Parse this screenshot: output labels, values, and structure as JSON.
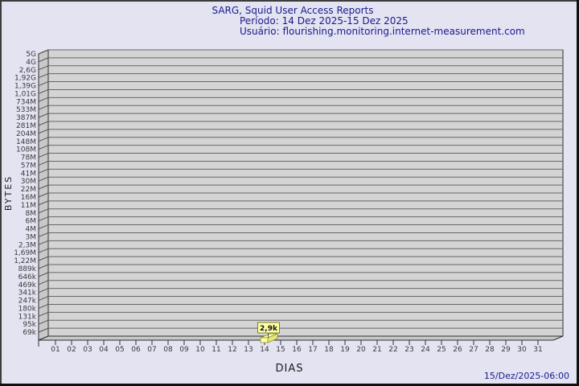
{
  "header": {
    "title": "SARG, Squid User Access Reports",
    "period": "Período: 14 Dez 2025-15 Dez 2025",
    "user": "Usuário: flourishing.monitoring.internet-measurement.com"
  },
  "footer": {
    "timestamp": "15/Dez/2025-06:00"
  },
  "colors": {
    "background": "#e3e3f2",
    "title_text": "#1a1a8c",
    "plot_face": "#d4d4d4",
    "plot_wall": "#c9c9c9",
    "gridline": "#666666",
    "axis_text": "#3a3a3a",
    "bar_fill": "#ffffa0",
    "bar_border": "#8f8f3f",
    "value_box_fill": "#ffffa8"
  },
  "chart_data": {
    "type": "bar",
    "title": "SARG, Squid User Access Reports",
    "subtitle": "Período: 14 Dez 2025-15 Dez 2025",
    "xlabel": "DIAS",
    "ylabel": "BYTES",
    "categories": [
      "01",
      "02",
      "03",
      "04",
      "05",
      "06",
      "07",
      "08",
      "09",
      "10",
      "11",
      "12",
      "13",
      "14",
      "15",
      "16",
      "17",
      "18",
      "19",
      "20",
      "21",
      "22",
      "23",
      "24",
      "25",
      "26",
      "27",
      "28",
      "29",
      "30",
      "31"
    ],
    "values": [
      0,
      0,
      0,
      0,
      0,
      0,
      0,
      0,
      0,
      0,
      0,
      0,
      0,
      2900,
      0,
      0,
      0,
      0,
      0,
      0,
      0,
      0,
      0,
      0,
      0,
      0,
      0,
      0,
      0,
      0,
      0
    ],
    "value_labels": {
      "14": "2,9k"
    },
    "y_tick_labels": [
      "5G",
      "4G",
      "2,6G",
      "1,92G",
      "1,39G",
      "1,01G",
      "734M",
      "533M",
      "387M",
      "281M",
      "204M",
      "148M",
      "108M",
      "78M",
      "57M",
      "41M",
      "30M",
      "22M",
      "16M",
      "11M",
      "8M",
      "6M",
      "4M",
      "3M",
      "2,3M",
      "1,69M",
      "1,22M",
      "889k",
      "646k",
      "469k",
      "341k",
      "247k",
      "180k",
      "131k",
      "95k",
      "69k"
    ],
    "y_axis_note": "non-linear byte scale, evenly spaced tick rows",
    "grid": "horizontal gridlines on, 3D left wall and floor",
    "legend": "none"
  }
}
